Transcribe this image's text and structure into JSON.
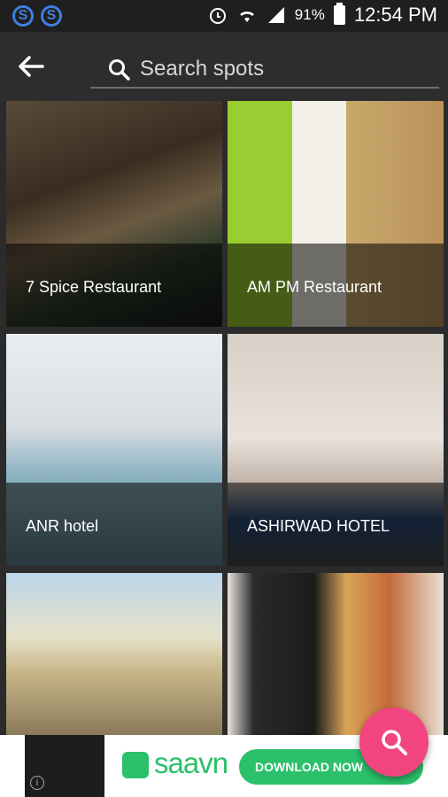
{
  "status_bar": {
    "battery": "91%",
    "time": "12:54 PM"
  },
  "toolbar": {
    "search_placeholder": "Search spots"
  },
  "spots": [
    {
      "name": "7 Spice Restaurant"
    },
    {
      "name": "AM PM Restaurant"
    },
    {
      "name": "ANR hotel"
    },
    {
      "name": "ASHIRWAD HOTEL"
    },
    {
      "name": ""
    },
    {
      "name": ""
    }
  ],
  "ad": {
    "brand": "saavn",
    "cta": "DOWNLOAD NOW",
    "info": "i"
  },
  "colors": {
    "accent": "#f2457f",
    "saavn_green": "#2bc06a",
    "toolbar": "#2d2d2d"
  }
}
